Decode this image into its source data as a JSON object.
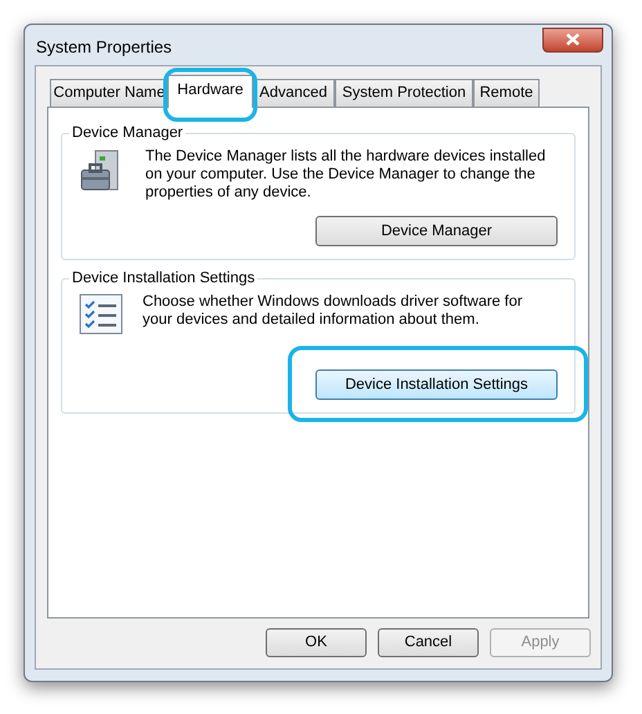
{
  "window": {
    "title": "System Properties"
  },
  "tabs": [
    {
      "label": "Computer Name",
      "selected": false,
      "highlighted": false
    },
    {
      "label": "Hardware",
      "selected": true,
      "highlighted": true
    },
    {
      "label": "Advanced",
      "selected": false,
      "highlighted": false
    },
    {
      "label": "System Protection",
      "selected": false,
      "highlighted": false
    },
    {
      "label": "Remote",
      "selected": false,
      "highlighted": false
    }
  ],
  "groups": [
    {
      "title": "Device Manager",
      "kind": "device-manager",
      "description": "The Device Manager lists all the hardware devices installed on your computer. Use the Device Manager to change the properties of any device.",
      "button": {
        "label": "Device Manager",
        "focused": false,
        "highlighted": false
      }
    },
    {
      "title": "Device Installation Settings",
      "kind": "installation",
      "description": "Choose whether Windows downloads driver software for your devices and detailed information about them.",
      "button": {
        "label": "Device Installation Settings",
        "focused": true,
        "highlighted": true
      }
    }
  ],
  "buttons": [
    {
      "label": "OK",
      "disabled": false
    },
    {
      "label": "Cancel",
      "disabled": false
    },
    {
      "label": "Apply",
      "disabled": true
    }
  ]
}
